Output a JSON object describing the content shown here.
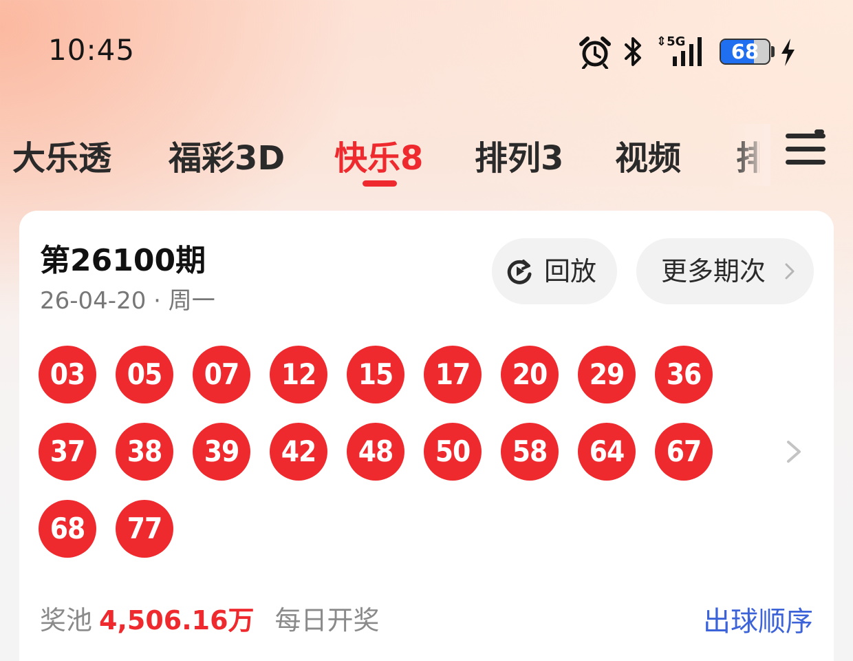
{
  "status_bar": {
    "time": "10:45",
    "network": "5G",
    "battery": "68",
    "battery_level": 0.68,
    "icons": [
      "alarm-icon",
      "bluetooth-icon",
      "signal-icon",
      "battery-icon",
      "charging-icon"
    ]
  },
  "tabs": [
    {
      "label": "大乐透",
      "active": false
    },
    {
      "label": "福彩3D",
      "active": false
    },
    {
      "label": "快乐8",
      "active": true
    },
    {
      "label": "排列3",
      "active": false
    },
    {
      "label": "视频",
      "active": false
    },
    {
      "label": "排",
      "active": false
    }
  ],
  "card": {
    "period": "第26100期",
    "date": "26-04-20 · 周一",
    "replay_label": "回放",
    "more_label": "更多期次",
    "balls": [
      "03",
      "05",
      "07",
      "12",
      "15",
      "17",
      "20",
      "29",
      "36",
      "37",
      "38",
      "39",
      "42",
      "48",
      "50",
      "58",
      "64",
      "67",
      "68",
      "77"
    ],
    "pool_label": "奖池",
    "pool_amount": "4,506.16万",
    "frequency": "每日开奖",
    "order_link": "出球顺序"
  },
  "colors": {
    "accent": "#ee2a2e",
    "link": "#3c63d8",
    "battery": "#1f6ff0"
  }
}
